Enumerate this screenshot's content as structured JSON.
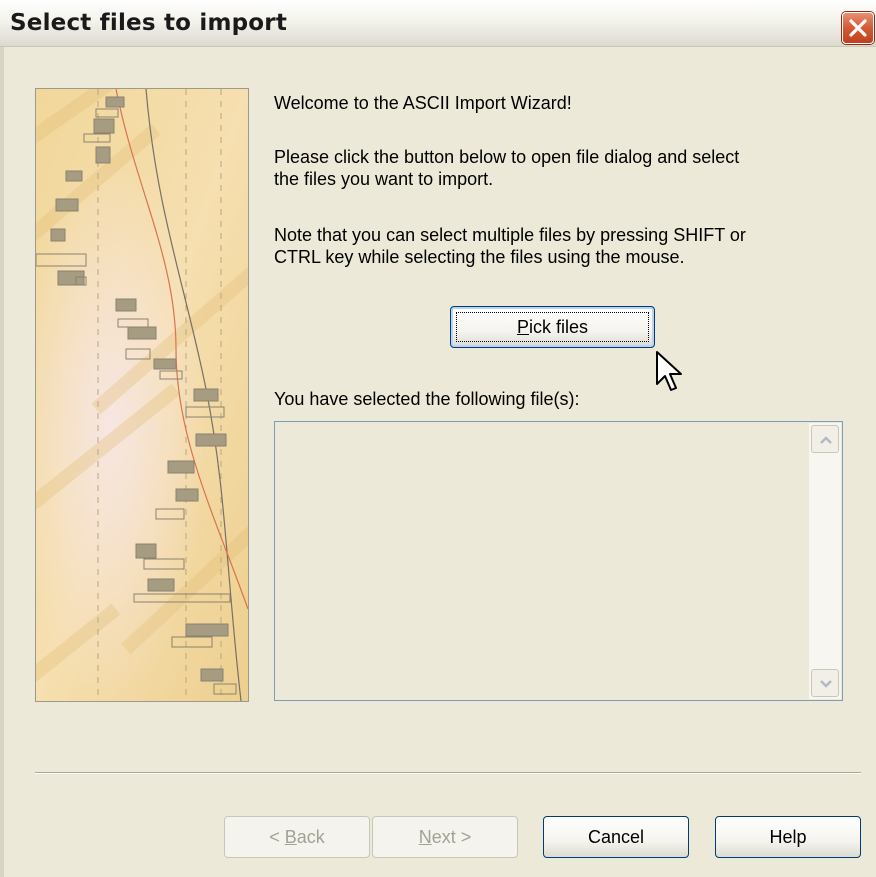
{
  "dialog": {
    "title": "Select files to import",
    "close_icon": "close-x-icon",
    "accent": "#c1401d"
  },
  "content": {
    "welcome": "Welcome to the ASCII Import Wizard!",
    "instruction_line1": "Please click the button below to open file dialog and select",
    "instruction_line2": "the files you want to import.",
    "note_line1": "Note that you can select multiple files by pressing SHIFT or",
    "note_line2": "CTRL key while selecting the files using the mouse.",
    "pick_files": {
      "accel": "P",
      "rest": "ick files"
    },
    "selected_label": "You have selected the following file(s):",
    "selected_files": []
  },
  "footer": {
    "back": {
      "prefix": "< ",
      "accel": "B",
      "rest": "ack"
    },
    "next": {
      "accel": "N",
      "rest": "ext >"
    },
    "cancel": "Cancel",
    "help": "Help"
  }
}
